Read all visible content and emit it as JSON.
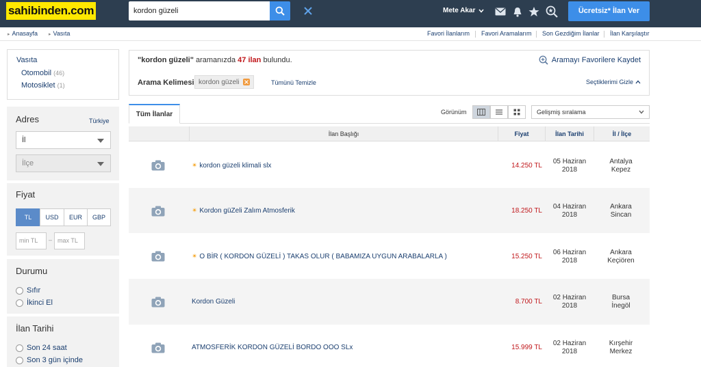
{
  "header": {
    "logo": "sahibinden.com",
    "search_value": "kordon güzeli",
    "user_name": "Mete Akar",
    "post_button": "Ücretsiz* İlan Ver"
  },
  "breadcrumb": [
    "Anasayfa",
    "Vasıta"
  ],
  "top_links": [
    "Favori İlanlarım",
    "Favori Aramalarım",
    "Son Gezdiğim İlanlar",
    "İlan Karşılaştır"
  ],
  "sidebar": {
    "category_title": "Vasıta",
    "categories": [
      {
        "label": "Otomobil",
        "count": "(46)"
      },
      {
        "label": "Motosiklet",
        "count": "(1)"
      }
    ],
    "address": {
      "title": "Adres",
      "country": "Türkiye",
      "city_placeholder": "İl",
      "district_placeholder": "İlçe"
    },
    "price": {
      "title": "Fiyat",
      "currencies": [
        "TL",
        "USD",
        "EUR",
        "GBP"
      ],
      "active_currency": "TL",
      "min_placeholder": "min TL",
      "dash": "–",
      "max_placeholder": "max TL"
    },
    "condition": {
      "title": "Durumu",
      "options": [
        "Sıfır",
        "İkinci El"
      ]
    },
    "date": {
      "title": "İlan Tarihi",
      "options": [
        "Son 24 saat",
        "Son 3 gün içinde"
      ]
    }
  },
  "results": {
    "query_quoted": "\"kordon güzeli\"",
    "text_middle": "aramanızda",
    "count": "47 ilan",
    "text_end": "bulundu.",
    "save_search": "Aramayı Favorilere Kaydet",
    "keyword_label": "Arama Kelimesi",
    "keyword_chip": "kordon güzeli",
    "clear_all": "Tümünü Temizle",
    "hide_selections": "Seçtiklerimi Gizle"
  },
  "tabs": {
    "all_listings": "Tüm İlanlar"
  },
  "view": {
    "label": "Görünüm",
    "sort": "Gelişmiş sıralama"
  },
  "table": {
    "headers": {
      "title": "İlan Başlığı",
      "price": "Fiyat",
      "date": "İlan Tarihi",
      "location": "İl / İlçe"
    },
    "rows": [
      {
        "title": "kordon güzeli klimali slx",
        "price": "14.250 TL",
        "date1": "05 Haziran",
        "date2": "2018",
        "city": "Antalya",
        "district": "Kepez",
        "star": true
      },
      {
        "title": "Kordon güZeli Zalım Atmosferik",
        "price": "18.250 TL",
        "date1": "04 Haziran",
        "date2": "2018",
        "city": "Ankara",
        "district": "Sincan",
        "star": true
      },
      {
        "title": "O BİR ( KORDON GÜZELİ ) TAKAS OLUR ( BABAMIZA UYGUN ARABALARLA )",
        "price": "15.250 TL",
        "date1": "06 Haziran",
        "date2": "2018",
        "city": "Ankara",
        "district": "Keçiören",
        "star": true
      },
      {
        "title": "Kordon Güzeli",
        "price": "8.700 TL",
        "date1": "02 Haziran",
        "date2": "2018",
        "city": "Bursa",
        "district": "İnegöl",
        "star": false
      },
      {
        "title": "ATMOSFERİK KORDON GÜZELİ BORDO OOO SLx",
        "price": "15.999 TL",
        "date1": "02 Haziran",
        "date2": "2018",
        "city": "Kırşehir",
        "district": "Merkez",
        "star": false
      }
    ]
  },
  "colors": {
    "header_bg": "#2d3e50",
    "accent": "#3d8ee8",
    "logo_bg": "#ffe800",
    "price": "#c0161a",
    "link": "#1a3e6f"
  }
}
